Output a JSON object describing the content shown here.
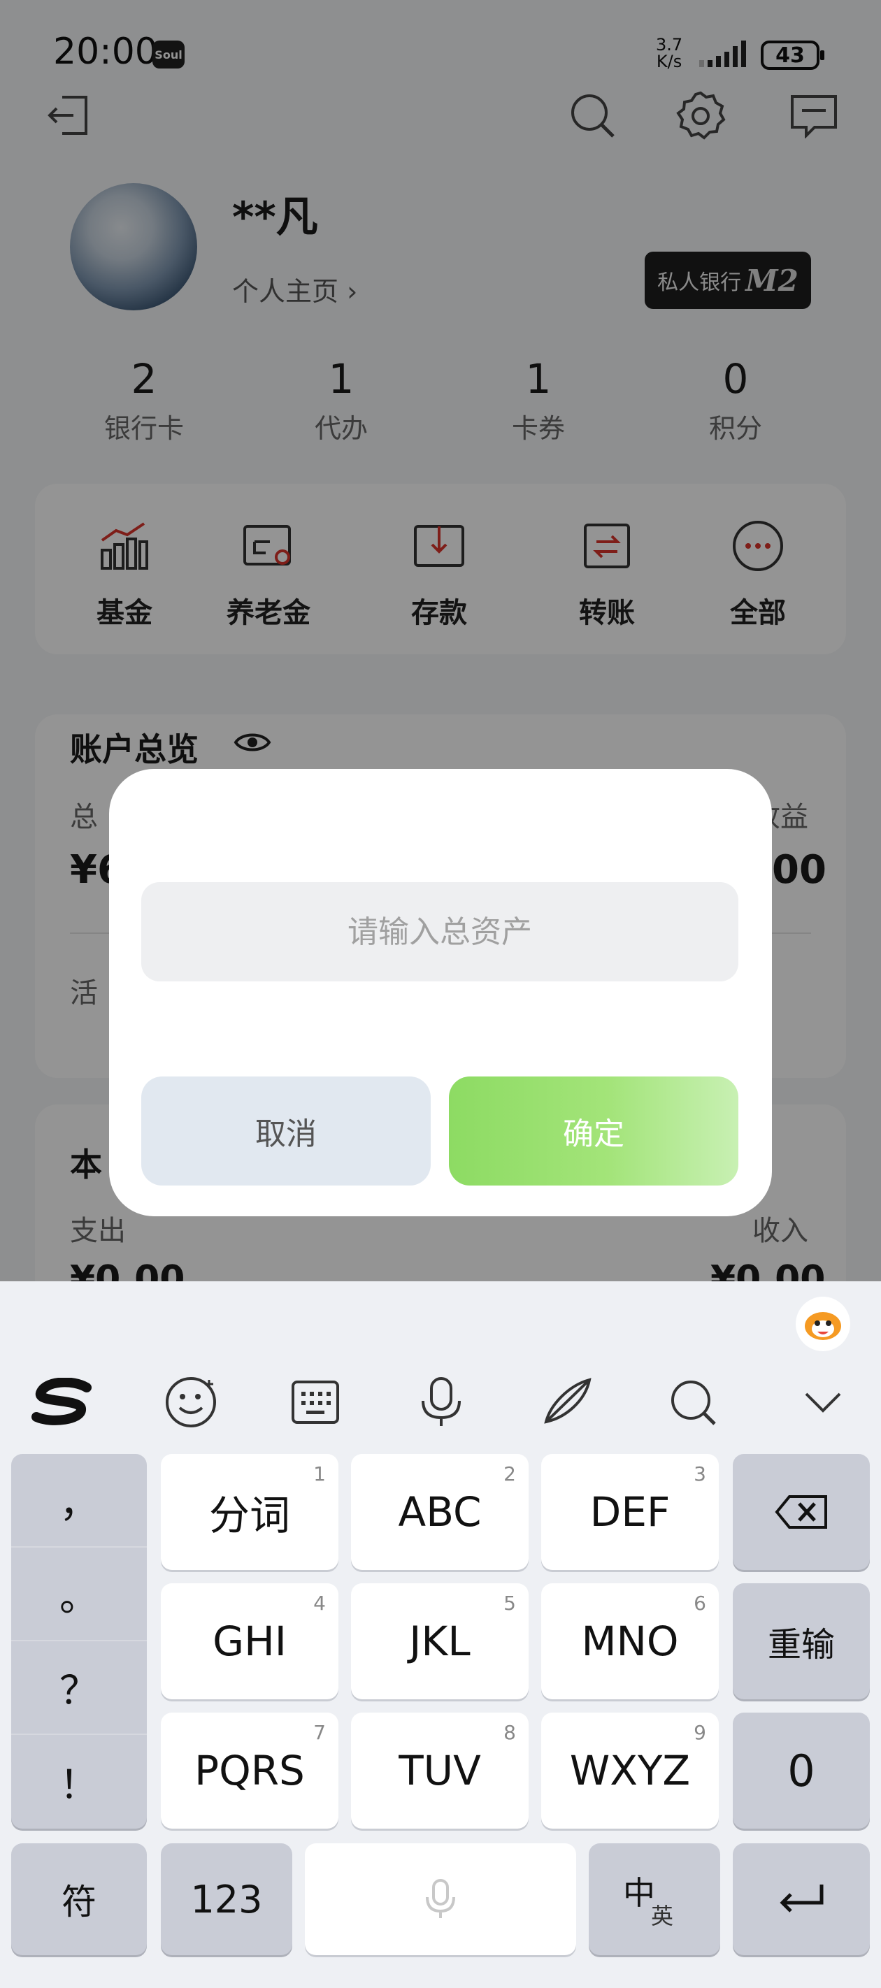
{
  "status_bar": {
    "time": "20:00",
    "app_badge": "Soul",
    "net_speed_value": "3.7",
    "net_speed_unit": "K/s",
    "battery": "43"
  },
  "header_icons": [
    "logout-icon",
    "search-icon",
    "gear-icon",
    "message-icon"
  ],
  "profile": {
    "name": "**凡",
    "homepage_link": "个人主页",
    "private_bank_label": "私人银行",
    "private_bank_level": "M2"
  },
  "stats": [
    {
      "value": "2",
      "label": "银行卡"
    },
    {
      "value": "1",
      "label": "代办"
    },
    {
      "value": "1",
      "label": "卡券"
    },
    {
      "value": "0",
      "label": "积分"
    }
  ],
  "quick_actions": [
    {
      "label": "基金",
      "icon": "fund-chart-icon"
    },
    {
      "label": "养老金",
      "icon": "pension-icon"
    },
    {
      "label": "存款",
      "icon": "deposit-icon"
    },
    {
      "label": "转账",
      "icon": "transfer-icon"
    },
    {
      "label": "全部",
      "icon": "more-dots-icon"
    }
  ],
  "account_overview": {
    "title": "账户总览",
    "left_label_partial": "总",
    "right_label_partial": "收益",
    "left_value_partial": "¥6",
    "right_value_partial": "00",
    "row_partial": "活"
  },
  "month_card": {
    "title_partial": "本",
    "expense_label": "支出",
    "income_label": "收入",
    "expense_value": "¥0.00",
    "income_value": "¥0.00"
  },
  "dialog": {
    "input_placeholder": "请输入总资产",
    "cancel_label": "取消",
    "confirm_label": "确定"
  },
  "keyboard": {
    "toolbar": [
      "sogou-logo-icon",
      "emoji-icon",
      "keyboard-icon",
      "microphone-icon",
      "handwriting-pen-icon",
      "search-icon",
      "collapse-chevron-icon"
    ],
    "punctuation": [
      "，",
      "。",
      "？",
      "！"
    ],
    "rows": [
      [
        {
          "label": "分词",
          "num": "1"
        },
        {
          "label": "ABC",
          "num": "2"
        },
        {
          "label": "DEF",
          "num": "3"
        }
      ],
      [
        {
          "label": "GHI",
          "num": "4"
        },
        {
          "label": "JKL",
          "num": "5"
        },
        {
          "label": "MNO",
          "num": "6"
        }
      ],
      [
        {
          "label": "PQRS",
          "num": "7"
        },
        {
          "label": "TUV",
          "num": "8"
        },
        {
          "label": "WXYZ",
          "num": "9"
        }
      ]
    ],
    "retype_label": "重输",
    "zero_label": "0",
    "symbol_label": "符",
    "num_label": "123",
    "lang_main": "中",
    "lang_sub": "英"
  }
}
